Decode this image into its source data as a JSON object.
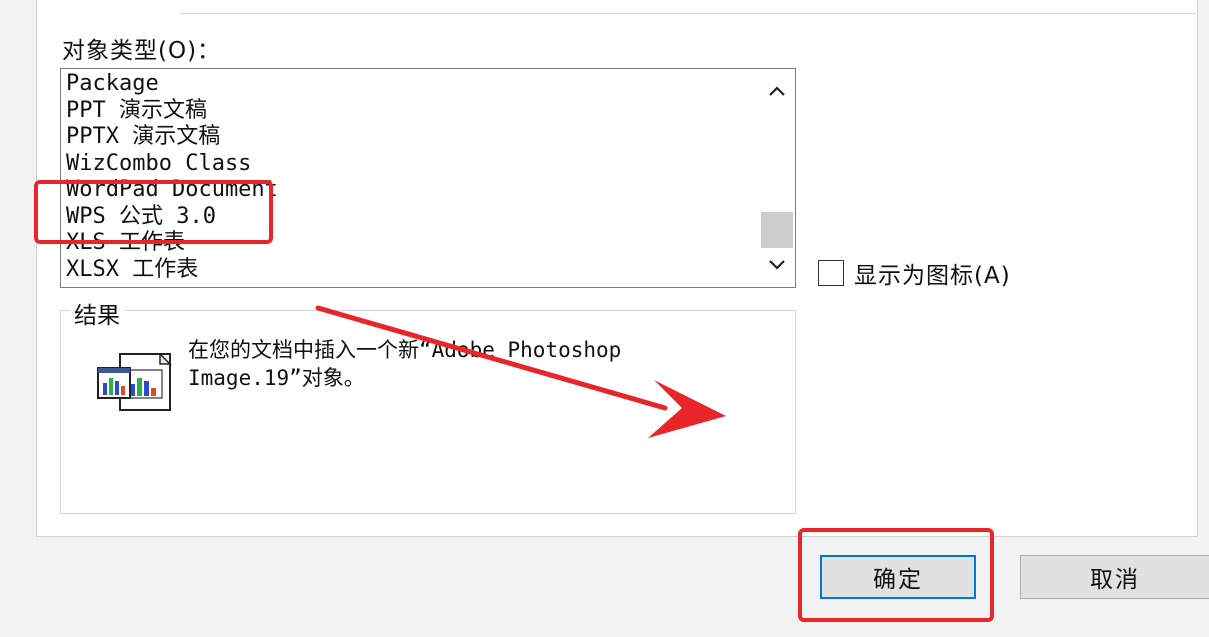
{
  "dialog": {
    "object_type_label": "对象类型(O)：",
    "object_types": [
      "Package",
      "PPT 演示文稿",
      "PPTX 演示文稿",
      "WizCombo Class",
      "WordPad Document",
      "WPS 公式 3.0",
      "XLS 工作表",
      "XLSX 工作表"
    ],
    "display_as_icon_label": "显示为图标(A)",
    "display_as_icon_checked": false,
    "result_label": "结果",
    "result_text": "在您的文档中插入一个新“Adobe Photoshop Image.19”对象。",
    "ok_label": "确定",
    "cancel_label": "取消"
  },
  "icons": {
    "scroll_up": "chevron-up-icon",
    "scroll_down": "chevron-down-icon",
    "result": "embedded-object-icon"
  },
  "colors": {
    "annotation_red": "#e8262a",
    "focus_blue": "#0078d7",
    "button_gray": "#e1e1e1"
  }
}
